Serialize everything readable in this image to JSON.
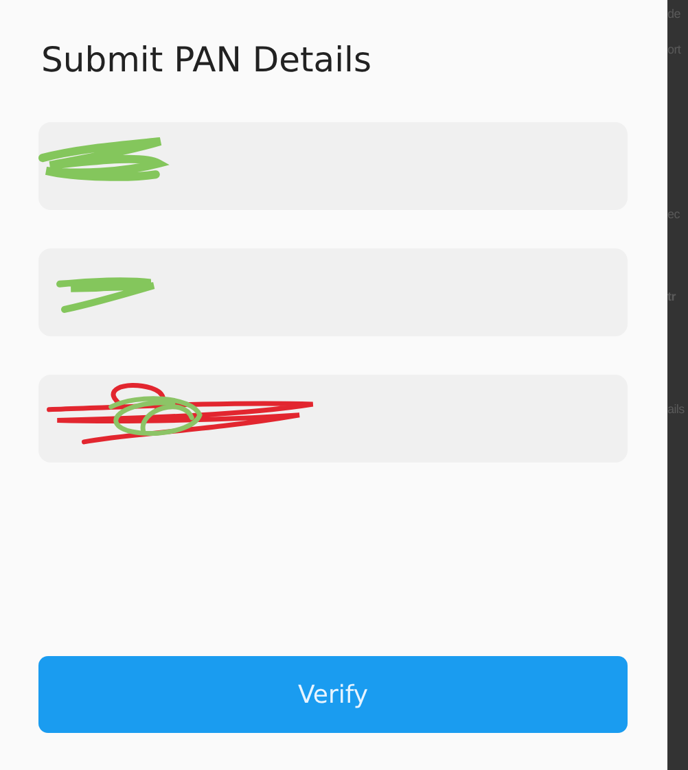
{
  "dialog": {
    "title": "Submit PAN Details",
    "fields": [
      {
        "scribbles": [
          {
            "color": "#84c65c"
          }
        ]
      },
      {
        "scribbles": [
          {
            "color": "#84c65c"
          }
        ]
      },
      {
        "scribbles": [
          {
            "color": "#e2262f"
          },
          {
            "color": "#8cc466"
          }
        ]
      }
    ],
    "button": "Verify"
  },
  "background_page": {
    "fragments": [
      "de",
      "ort",
      "ec",
      "tr",
      "ails"
    ]
  }
}
